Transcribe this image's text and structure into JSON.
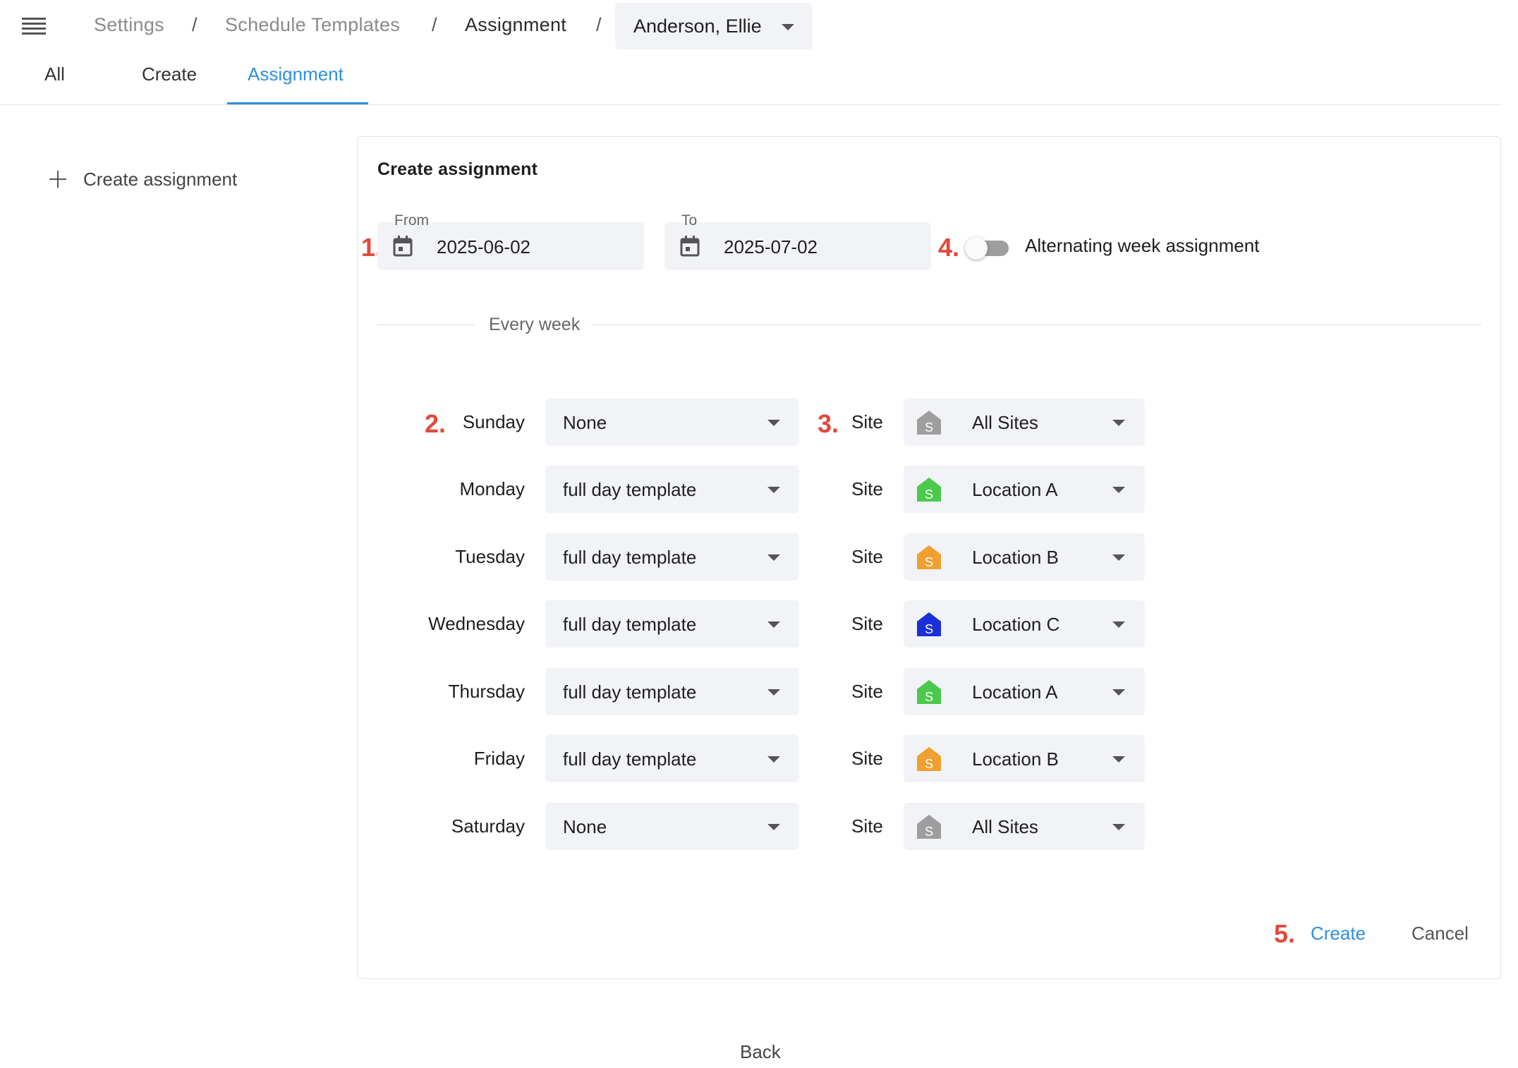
{
  "breadcrumb": {
    "items": [
      "Settings",
      "Schedule Templates",
      "Assignment"
    ],
    "separator": "/",
    "selected_user": "Anderson, Ellie"
  },
  "tabs": [
    {
      "label": "All",
      "active": false
    },
    {
      "label": "Create",
      "active": false
    },
    {
      "label": "Assignment",
      "active": true
    }
  ],
  "sidebar": {
    "create_label": "Create assignment"
  },
  "form": {
    "title": "Create assignment",
    "from": {
      "label": "From",
      "value": "2025-06-02"
    },
    "to": {
      "label": "To",
      "value": "2025-07-02"
    },
    "alternating": {
      "label": "Alternating week assignment",
      "checked": false
    },
    "section_label": "Every week",
    "site_label": "Site",
    "days": [
      {
        "day": "Sunday",
        "template": "None",
        "site": "All Sites",
        "site_color": "#9e9e9e"
      },
      {
        "day": "Monday",
        "template": "full day template",
        "site": "Location A",
        "site_color": "#4cc94c"
      },
      {
        "day": "Tuesday",
        "template": "full day template",
        "site": "Location B",
        "site_color": "#f0a030"
      },
      {
        "day": "Wednesday",
        "template": "full day template",
        "site": "Location C",
        "site_color": "#1a2fd6"
      },
      {
        "day": "Thursday",
        "template": "full day template",
        "site": "Location A",
        "site_color": "#4cc94c"
      },
      {
        "day": "Friday",
        "template": "full day template",
        "site": "Location B",
        "site_color": "#f0a030"
      },
      {
        "day": "Saturday",
        "template": "None",
        "site": "All Sites",
        "site_color": "#9e9e9e"
      }
    ],
    "create_label": "Create",
    "cancel_label": "Cancel"
  },
  "annotations": [
    "1.",
    "2.",
    "3.",
    "4.",
    "5."
  ],
  "back_label": "Back",
  "colors": {
    "accent": "#2f8fe0",
    "annotation": "#e04a3c",
    "field_bg": "#f1f3f6"
  }
}
